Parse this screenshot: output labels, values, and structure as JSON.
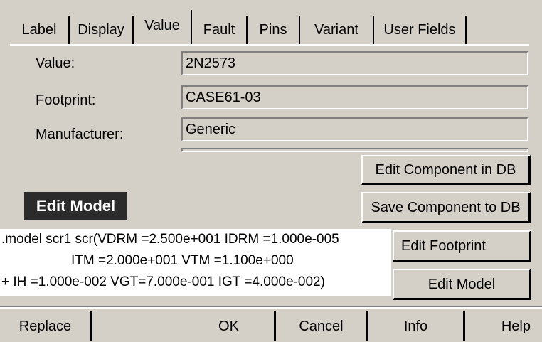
{
  "tabs": [
    "Label",
    "Display",
    "Value",
    "Fault",
    "Pins",
    "Variant",
    "User Fields"
  ],
  "fields": {
    "value_label": "Value:",
    "value": "2N2573",
    "footprint_label": "Footprint:",
    "footprint": "CASE61-03",
    "manufacturer_label": "Manufacturer:",
    "manufacturer": "Generic"
  },
  "buttons": {
    "edit_component_db": "Edit Component in DB",
    "save_component_db": "Save Component to DB",
    "edit_footprint": "Edit Footprint",
    "edit_model": "Edit Model"
  },
  "callout": "Edit Model",
  "model_text": {
    "line1": ".model scr1 scr(VDRM =2.500e+001 IDRM =1.000e-005",
    "line2": "ITM =2.000e+001 VTM =1.100e+000",
    "line3": "+ IH =1.000e-002 VGT=7.000e-001 IGT =4.000e-002)"
  },
  "bottom": {
    "replace": "Replace",
    "ok": "OK",
    "cancel": "Cancel",
    "info": "Info",
    "help": "Help"
  }
}
